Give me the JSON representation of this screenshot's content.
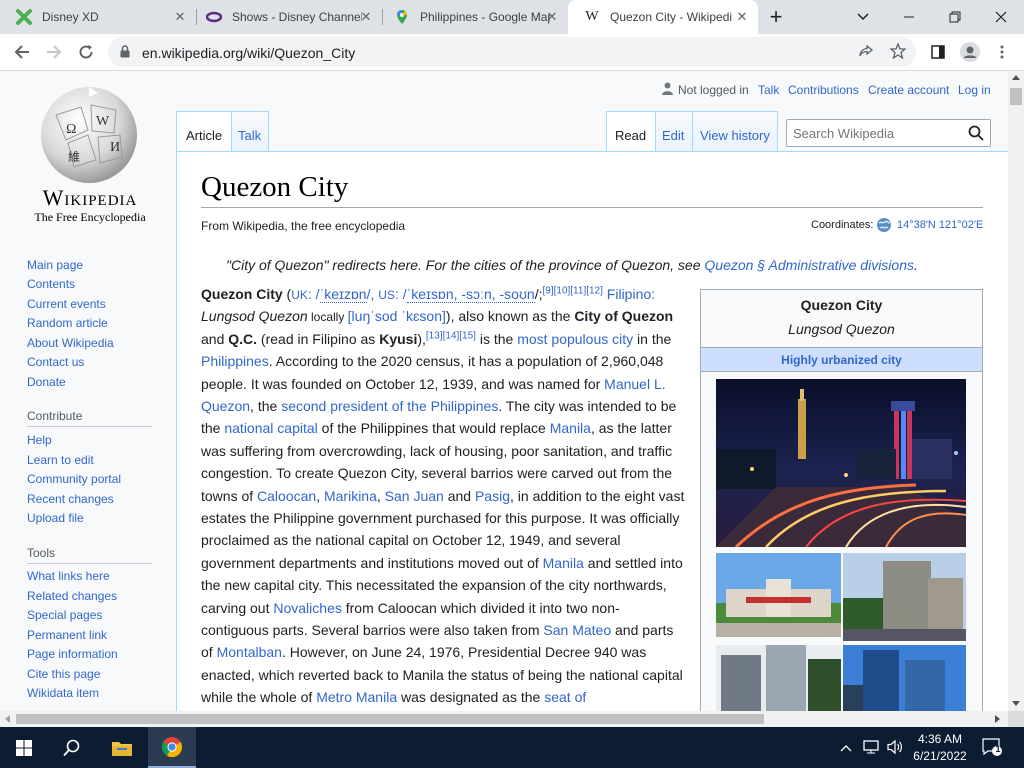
{
  "browser": {
    "tabs": [
      {
        "title": "Disney XD",
        "icon": "disney-xd-icon"
      },
      {
        "title": "Shows - Disney Channel",
        "icon": "disney-channel-icon"
      },
      {
        "title": "Philippines - Google Maps",
        "icon": "google-maps-icon"
      },
      {
        "title": "Quezon City - Wikipedia",
        "icon": "wikipedia-icon"
      }
    ],
    "new_tab": "+",
    "url": "en.wikipedia.org/wiki/Quezon_City"
  },
  "wiki": {
    "logo_wordmark": "Wikipedia",
    "logo_tagline": "The Free Encyclopedia",
    "personal": [
      "Not logged in",
      "Talk",
      "Contributions",
      "Create account",
      "Log in"
    ],
    "tabs_left": [
      "Article",
      "Talk"
    ],
    "tabs_right": [
      "Read",
      "Edit",
      "View history"
    ],
    "search_placeholder": "Search Wikipedia",
    "nav_main": [
      "Main page",
      "Contents",
      "Current events",
      "Random article",
      "About Wikipedia",
      "Contact us",
      "Donate"
    ],
    "contribute_heading": "Contribute",
    "nav_contribute": [
      "Help",
      "Learn to edit",
      "Community portal",
      "Recent changes",
      "Upload file"
    ],
    "tools_heading": "Tools",
    "nav_tools": [
      "What links here",
      "Related changes",
      "Special pages",
      "Permanent link",
      "Page information",
      "Cite this page",
      "Wikidata item"
    ],
    "title": "Quezon City",
    "from": "From Wikipedia, the free encyclopedia",
    "coordinates_label": "Coordinates:",
    "coordinates_value": "14°38′N 121°02′E",
    "hatnote": "\"City of Quezon\" redirects here. For the cities of the province of Quezon, see",
    "hatnote_link": "Quezon § Administrative divisions",
    "infobox": {
      "name": "Quezon City",
      "native_name": "Lungsod Quezon",
      "type": "Highly urbanized city"
    },
    "paragraph": {
      "l1a": "Quezon City",
      "l1b": " (",
      "l1c": "UK",
      "l1d": ": /",
      "l1e": "ˈkeɪzɒn",
      "l1f": "/, ",
      "l1g": "US",
      "l1h": ": /",
      "l1i": "ˈkeɪsɒn, -sɔːn, -soʊn",
      "l1j": "/;",
      "l1k": "[9][10][11][12]",
      "l1l": " Filipino:",
      "l2a": "Lungsod Quezon",
      "l2b": " locally ",
      "l2c": "[luŋˈsod ˈkɛson]",
      "l2d": "), also known as the ",
      "l2e": "City of Quezon",
      "l3a": "and ",
      "l3b": "Q.C.",
      "l3c": " (read in Filipino as ",
      "l3d": "Kyusi",
      "l3e": "),",
      "l3f": "[13][14][15]",
      "l3g": " is the ",
      "l3h": "most populous city",
      "l3i": " in the",
      "l4a": "Philippines",
      "l4b": ". According to the 2020 census, it has a population of 2,960,048",
      "l5a": "people. It was founded on October 12, 1939, and was named for ",
      "l5b": "Manuel L.",
      "l6a": "Quezon",
      "l6b": ", the ",
      "l6c": "second president of the Philippines",
      "l6d": ". The city was intended to be",
      "l7a": "the ",
      "l7b": "national capital",
      "l7c": " of the Philippines that would replace ",
      "l7d": "Manila",
      "l7e": ", as the latter",
      "l8": "was suffering from overcrowding, lack of housing, poor sanitation, and traffic",
      "l9": "congestion. To create Quezon City, several barrios were carved out from the",
      "l10a": "towns of ",
      "l10b": "Caloocan",
      "l10c": ", ",
      "l10d": "Marikina",
      "l10e": ", ",
      "l10f": "San Juan",
      "l10g": " and ",
      "l10h": "Pasig",
      "l10i": ", in addition to the eight vast",
      "l11": "estates the Philippine government purchased for this purpose. It was officially",
      "l12": "proclaimed as the national capital on October 12, 1949, and several",
      "l13a": "government departments and institutions moved out of ",
      "l13b": "Manila",
      "l13c": " and settled into",
      "l14": "the new capital city. This necessitated the expansion of the city northwards,",
      "l15a": "carving out ",
      "l15b": "Novaliches",
      "l15c": " from Caloocan which divided it into two non-",
      "l16a": "contiguous parts. Several barrios were also taken from ",
      "l16b": "San Mateo",
      "l16c": " and parts",
      "l17a": "of ",
      "l17b": "Montalban",
      "l17c": ". However, on June 24, 1976, Presidential Decree 940 was",
      "l18": "enacted, which reverted back to Manila the status of being the national capital",
      "l19a": "while the whole of ",
      "l19b": "Metro Manila",
      "l19c": " was designated as the ",
      "l19d": "seat of"
    }
  },
  "taskbar": {
    "time": "4:36 AM",
    "date": "6/21/2022",
    "notification_count": "1"
  }
}
